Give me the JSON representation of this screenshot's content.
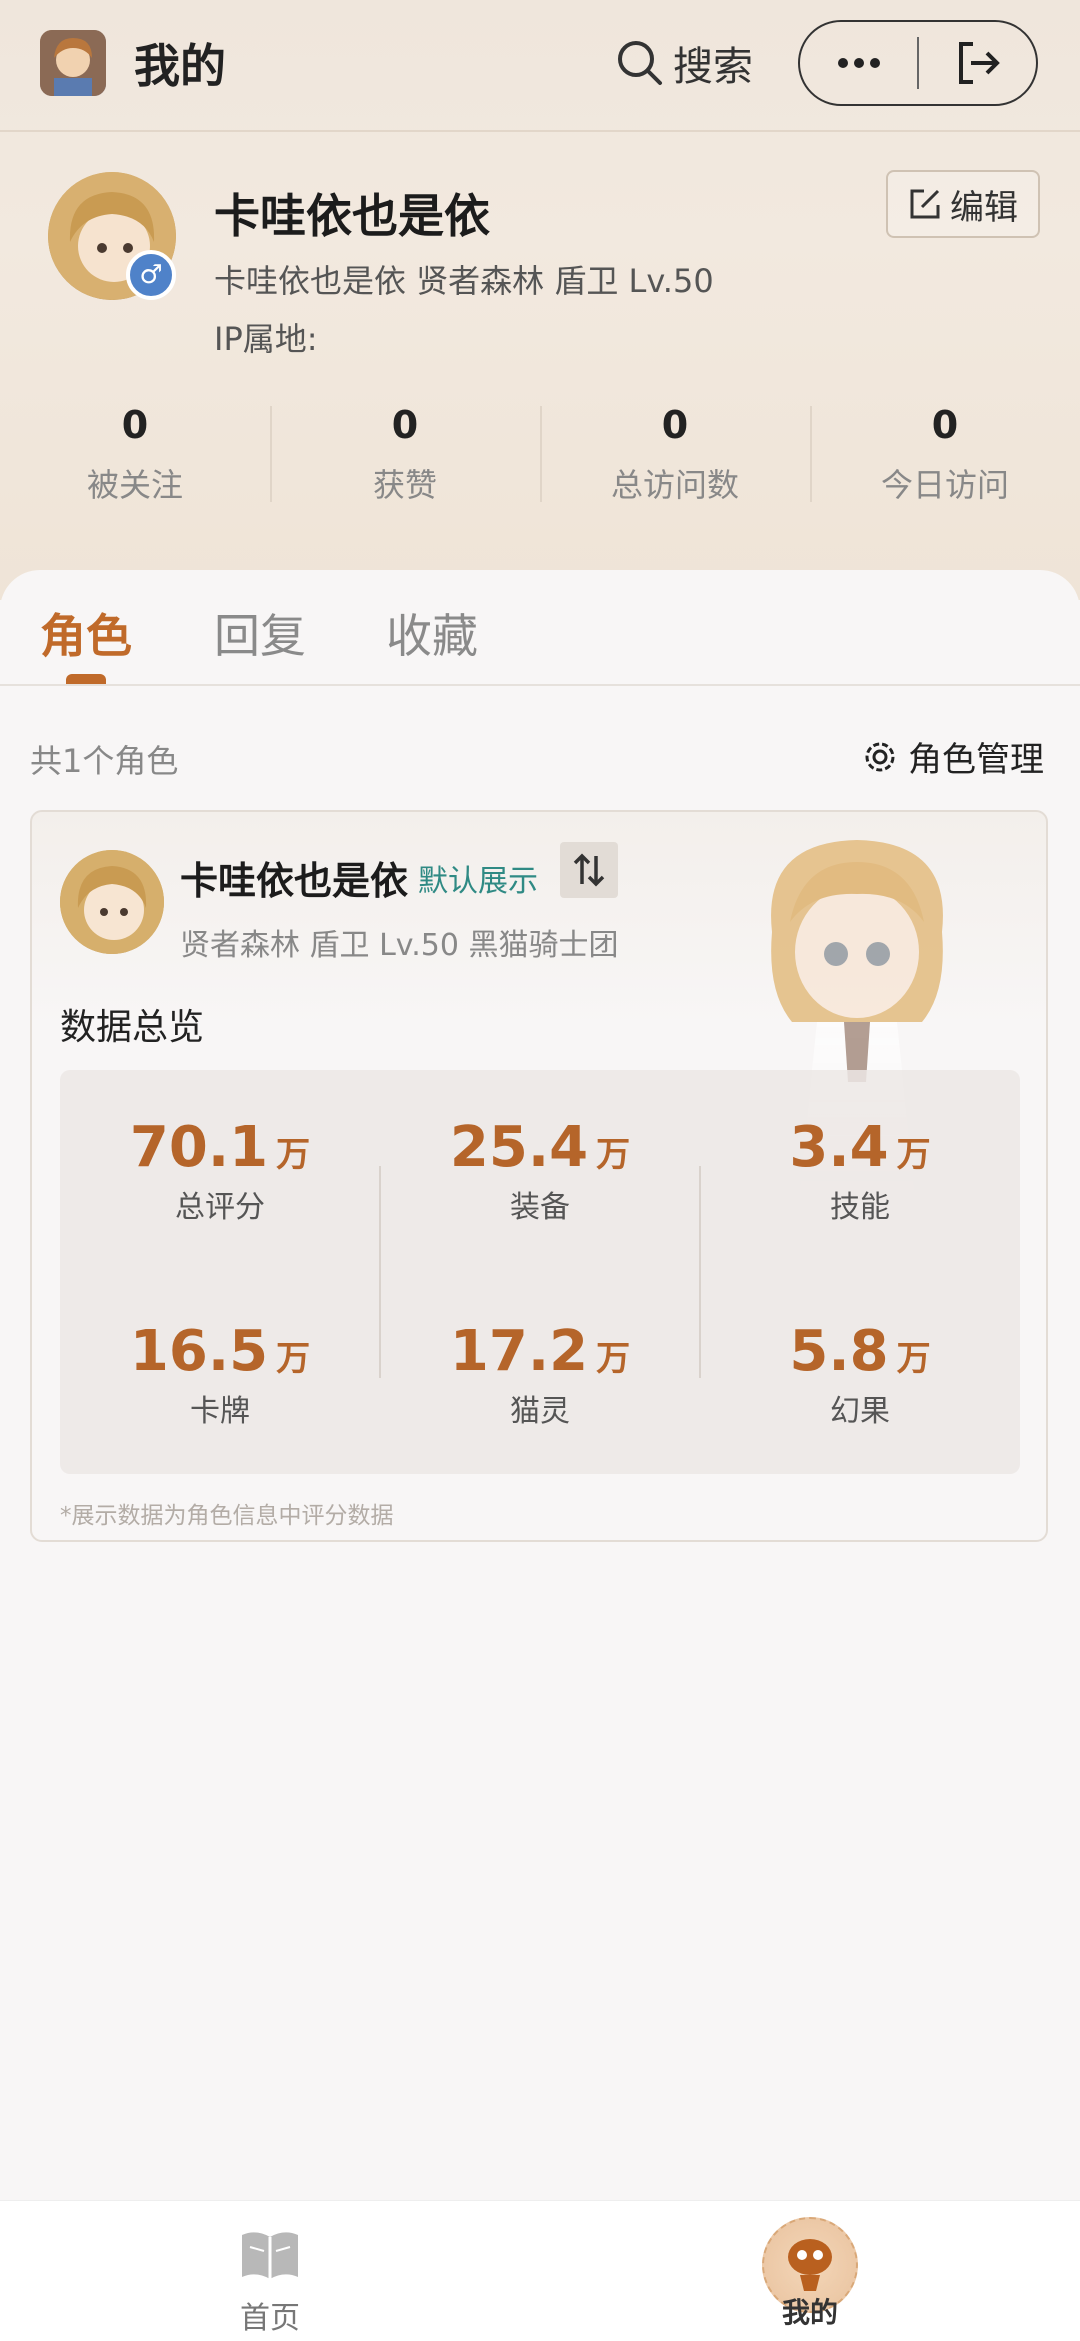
{
  "header": {
    "title": "我的",
    "search_label": "搜索"
  },
  "profile": {
    "name": "卡哇依也是依",
    "subtitle": "卡哇依也是依 贤者森林 盾卫 Lv.50",
    "ip_label": "IP属地:",
    "edit_label": "编辑",
    "gender_symbol": "♂"
  },
  "stats": [
    {
      "value": "0",
      "label": "被关注"
    },
    {
      "value": "0",
      "label": "获赞"
    },
    {
      "value": "0",
      "label": "总访问数"
    },
    {
      "value": "0",
      "label": "今日访问"
    }
  ],
  "tabs": [
    {
      "label": "角色",
      "active": true
    },
    {
      "label": "回复",
      "active": false
    },
    {
      "label": "收藏",
      "active": false
    }
  ],
  "roles_section": {
    "count_text": "共1个角色",
    "manage_label": "角色管理"
  },
  "character_card": {
    "name": "卡哇依也是依",
    "default_tag": "默认展示",
    "subtitle": "贤者森林 盾卫 Lv.50 黑猫骑士团",
    "overview_title": "数据总览",
    "metrics": [
      {
        "value": "70.1",
        "unit": "万",
        "label": "总评分"
      },
      {
        "value": "25.4",
        "unit": "万",
        "label": "装备"
      },
      {
        "value": "3.4",
        "unit": "万",
        "label": "技能"
      },
      {
        "value": "16.5",
        "unit": "万",
        "label": "卡牌"
      },
      {
        "value": "17.2",
        "unit": "万",
        "label": "猫灵"
      },
      {
        "value": "5.8",
        "unit": "万",
        "label": "幻果"
      }
    ],
    "note": "*展示数据为角色信息中评分数据"
  },
  "bottom_nav": {
    "home_label": "首页",
    "mine_label": "我的"
  },
  "colors": {
    "accent": "#c06a2a",
    "metric": "#b5652a",
    "tag": "#2f8a84"
  }
}
